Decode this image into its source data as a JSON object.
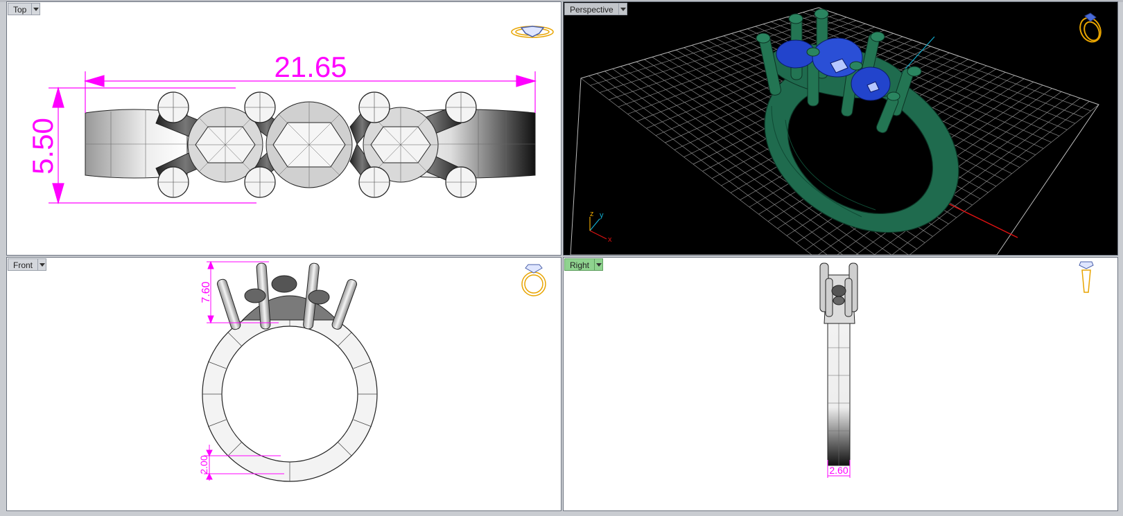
{
  "viewports": {
    "top": {
      "label": "Top",
      "dimensions": {
        "width": "21.65",
        "height": "5.50"
      }
    },
    "perspective": {
      "label": "Perspective",
      "axes": {
        "x": "x",
        "y": "y",
        "z": "z"
      }
    },
    "front": {
      "label": "Front",
      "dimensions": {
        "setting_height": "7.60",
        "band_thickness": "2.00"
      }
    },
    "right": {
      "label": "Right",
      "dimensions": {
        "band_width": "2.60"
      }
    }
  },
  "colors": {
    "dimension": "#ff00ff",
    "ring_green": "#1f6b4e",
    "gem_blue": "#2244cc",
    "grid": "#9a9a9a",
    "axis_red": "#dd1111",
    "axis_cyan": "#11aacc",
    "active_tab": "#8fd38f",
    "view_icon": "#e8a400"
  },
  "icons": [
    "top-view-ring-icon",
    "perspective-view-ring-icon",
    "front-view-ring-icon",
    "right-view-ring-icon"
  ]
}
